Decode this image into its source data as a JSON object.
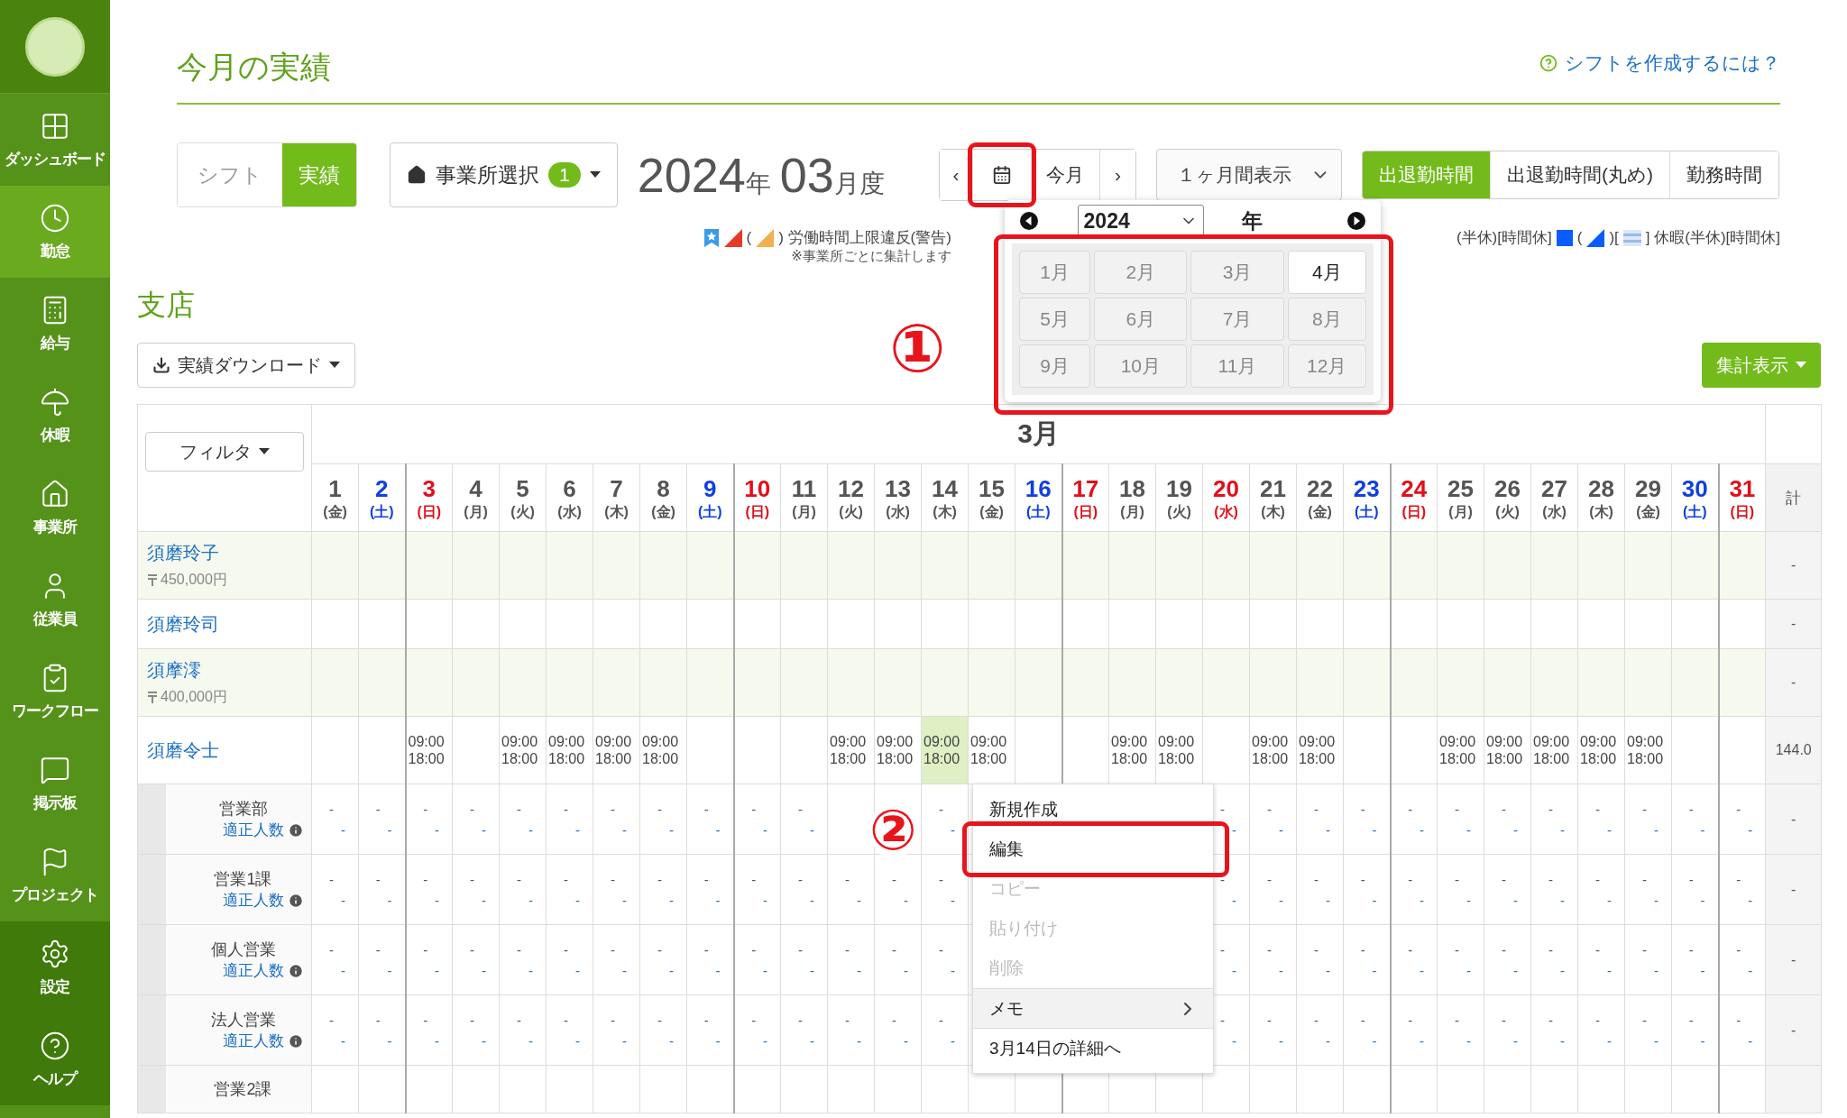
{
  "sidebar": {
    "items": [
      {
        "label": "ダッシュボード",
        "selected": false
      },
      {
        "label": "勤怠",
        "selected": true
      },
      {
        "label": "給与",
        "selected": false
      },
      {
        "label": "休暇",
        "selected": false
      },
      {
        "label": "事業所",
        "selected": false
      },
      {
        "label": "従業員",
        "selected": false
      },
      {
        "label": "ワークフロー",
        "selected": false
      },
      {
        "label": "掲示板",
        "selected": false
      },
      {
        "label": "プロジェクト",
        "selected": false
      }
    ],
    "bottom_items": [
      {
        "label": "設定",
        "selected": false
      },
      {
        "label": "ヘルプ",
        "selected": false
      }
    ]
  },
  "header": {
    "title": "今月の実績",
    "help_link": "シフトを作成するには？"
  },
  "toolbar": {
    "mode_tabs": [
      {
        "label": "シフト",
        "selected": false
      },
      {
        "label": "実績",
        "selected": true
      }
    ],
    "office_button": {
      "label": "事業所選択",
      "badge": "1"
    },
    "period": {
      "year": "2024",
      "year_unit": "年",
      "month": "03",
      "month_unit": "月度"
    },
    "nav": {
      "prev": "‹",
      "today": "今月",
      "next": "›",
      "calendar_annotated": true
    },
    "range_select": {
      "value": "１ヶ月間表示"
    },
    "view_tabs": [
      {
        "label": "出退勤時間",
        "selected": true
      },
      {
        "label": "出退勤時間(丸め)",
        "selected": false
      },
      {
        "label": "勤務時間",
        "selected": false
      }
    ]
  },
  "calendar_popup": {
    "year": "2024",
    "year_unit": "年",
    "annotated": true,
    "annotation": "①",
    "months": [
      {
        "label": "1月",
        "selected": false
      },
      {
        "label": "2月",
        "selected": false
      },
      {
        "label": "3月",
        "selected": false
      },
      {
        "label": "4月",
        "selected": true
      },
      {
        "label": "5月",
        "selected": false
      },
      {
        "label": "6月",
        "selected": false
      },
      {
        "label": "7月",
        "selected": false
      },
      {
        "label": "8月",
        "selected": false
      },
      {
        "label": "9月",
        "selected": false
      },
      {
        "label": "10月",
        "selected": false
      },
      {
        "label": "11月",
        "selected": false
      },
      {
        "label": "12月",
        "selected": false
      }
    ]
  },
  "legend": {
    "left": {
      "parts": [
        {
          "kind": "bookmark"
        },
        {
          "kind": "triangle",
          "color": "#e53a2a"
        },
        {
          "kind": "text",
          "text": "("
        },
        {
          "kind": "triangle",
          "color": "#f0b050"
        },
        {
          "kind": "text",
          "text": ") 労働時間上限違反(警告)"
        }
      ],
      "note": "※事業所ごとに集計します"
    },
    "right": {
      "parts": [
        {
          "kind": "text",
          "text": "(半休)[時間休]"
        },
        {
          "kind": "square",
          "color": "#0a5cff"
        },
        {
          "kind": "text",
          "text": "("
        },
        {
          "kind": "triangle",
          "color": "#0a5cff"
        },
        {
          "kind": "text",
          "text": ")["
        },
        {
          "kind": "stripes"
        },
        {
          "kind": "text",
          "text": "] 休暇(半休)[時間休]"
        }
      ]
    }
  },
  "section": {
    "title": "支店",
    "download_button": "実績ダウンロード",
    "summary_button": "集計表示"
  },
  "table": {
    "month_label": "3月",
    "filter_button": "フィルタ",
    "total_header": "計",
    "days": [
      {
        "num": "1",
        "wd": "(金)",
        "kind": "weekday"
      },
      {
        "num": "2",
        "wd": "(土)",
        "kind": "sat"
      },
      {
        "num": "3",
        "wd": "(日)",
        "kind": "sun"
      },
      {
        "num": "4",
        "wd": "(月)",
        "kind": "weekday"
      },
      {
        "num": "5",
        "wd": "(火)",
        "kind": "weekday"
      },
      {
        "num": "6",
        "wd": "(水)",
        "kind": "weekday"
      },
      {
        "num": "7",
        "wd": "(木)",
        "kind": "weekday"
      },
      {
        "num": "8",
        "wd": "(金)",
        "kind": "weekday"
      },
      {
        "num": "9",
        "wd": "(土)",
        "kind": "sat"
      },
      {
        "num": "10",
        "wd": "(日)",
        "kind": "sun"
      },
      {
        "num": "11",
        "wd": "(月)",
        "kind": "weekday"
      },
      {
        "num": "12",
        "wd": "(火)",
        "kind": "weekday"
      },
      {
        "num": "13",
        "wd": "(水)",
        "kind": "weekday"
      },
      {
        "num": "14",
        "wd": "(木)",
        "kind": "weekday"
      },
      {
        "num": "15",
        "wd": "(金)",
        "kind": "weekday"
      },
      {
        "num": "16",
        "wd": "(土)",
        "kind": "sat"
      },
      {
        "num": "17",
        "wd": "(日)",
        "kind": "sun"
      },
      {
        "num": "18",
        "wd": "(月)",
        "kind": "weekday"
      },
      {
        "num": "19",
        "wd": "(火)",
        "kind": "weekday"
      },
      {
        "num": "20",
        "wd": "(水)",
        "kind": "holiday"
      },
      {
        "num": "21",
        "wd": "(木)",
        "kind": "weekday"
      },
      {
        "num": "22",
        "wd": "(金)",
        "kind": "weekday"
      },
      {
        "num": "23",
        "wd": "(土)",
        "kind": "sat"
      },
      {
        "num": "24",
        "wd": "(日)",
        "kind": "sun"
      },
      {
        "num": "25",
        "wd": "(月)",
        "kind": "weekday"
      },
      {
        "num": "26",
        "wd": "(火)",
        "kind": "weekday"
      },
      {
        "num": "27",
        "wd": "(水)",
        "kind": "weekday"
      },
      {
        "num": "28",
        "wd": "(木)",
        "kind": "weekday"
      },
      {
        "num": "29",
        "wd": "(金)",
        "kind": "weekday"
      },
      {
        "num": "30",
        "wd": "(土)",
        "kind": "sat"
      },
      {
        "num": "31",
        "wd": "(日)",
        "kind": "sun"
      }
    ],
    "employees": [
      {
        "name": "須磨玲子",
        "salary": "450,000円",
        "shaded": true,
        "total": "-"
      },
      {
        "name": "須磨玲司",
        "shaded": false,
        "total": "-"
      },
      {
        "name": "須摩澪",
        "salary": "400,000円",
        "shaded": true,
        "total": "-"
      },
      {
        "name": "須磨令士",
        "shaded": false,
        "total": "144.0",
        "cells": [
          {
            "selected": false
          },
          {
            "selected": false
          },
          {
            "in": "09:00",
            "out": "18:00",
            "selected": false
          },
          {
            "selected": false
          },
          {
            "in": "09:00",
            "out": "18:00",
            "selected": false
          },
          {
            "in": "09:00",
            "out": "18:00",
            "selected": false
          },
          {
            "in": "09:00",
            "out": "18:00",
            "selected": false
          },
          {
            "in": "09:00",
            "out": "18:00",
            "selected": false
          },
          {
            "selected": false
          },
          {
            "selected": false
          },
          {
            "selected": false
          },
          {
            "in": "09:00",
            "out": "18:00",
            "selected": false
          },
          {
            "in": "09:00",
            "out": "18:00",
            "selected": false
          },
          {
            "in": "09:00",
            "out": "18:00",
            "selected": true
          },
          {
            "in": "09:00",
            "out": "18:00",
            "selected": false
          },
          {
            "selected": false
          },
          {
            "selected": false
          },
          {
            "in": "09:00",
            "out": "18:00",
            "selected": false
          },
          {
            "in": "09:00",
            "out": "18:00",
            "selected": false
          },
          {
            "selected": false
          },
          {
            "in": "09:00",
            "out": "18:00",
            "selected": false
          },
          {
            "in": "09:00",
            "out": "18:00",
            "selected": false
          },
          {
            "selected": false
          },
          {
            "selected": false
          },
          {
            "in": "09:00",
            "out": "18:00",
            "selected": false
          },
          {
            "in": "09:00",
            "out": "18:00",
            "selected": false
          },
          {
            "in": "09:00",
            "out": "18:00",
            "selected": false
          },
          {
            "in": "09:00",
            "out": "18:00",
            "selected": false
          },
          {
            "in": "09:00",
            "out": "18:00",
            "selected": false
          },
          {
            "selected": false
          },
          {
            "selected": false
          }
        ]
      }
    ],
    "groups": [
      {
        "label": "営業部",
        "link": "適正人数",
        "total": "-",
        "cells": [
          [
            "-",
            "-"
          ],
          [
            "-",
            "-"
          ],
          [
            "-",
            "-"
          ],
          [
            "-",
            "-"
          ],
          [
            "-",
            "-"
          ],
          [
            "-",
            "-"
          ],
          [
            "-",
            "-"
          ],
          [
            "-",
            "-"
          ],
          [
            "-",
            "-"
          ],
          [
            "-",
            "-"
          ],
          [
            "-",
            "-"
          ],
          null,
          null,
          [
            "-",
            "-"
          ],
          null,
          null,
          null,
          null,
          null,
          [
            "-",
            "-"
          ],
          [
            "-",
            "-"
          ],
          [
            "-",
            "-"
          ],
          [
            "-",
            "-"
          ],
          [
            "-",
            "-"
          ],
          [
            "-",
            "-"
          ],
          [
            "-",
            "-"
          ],
          [
            "-",
            "-"
          ],
          [
            "-",
            "-"
          ],
          [
            "-",
            "-"
          ],
          [
            "-",
            "-"
          ],
          [
            "-",
            "-"
          ]
        ]
      },
      {
        "label": "営業1課",
        "link": "適正人数",
        "total": "-",
        "cells": [
          [
            "-",
            "-"
          ],
          [
            "-",
            "-"
          ],
          [
            "-",
            "-"
          ],
          [
            "-",
            "-"
          ],
          [
            "-",
            "-"
          ],
          [
            "-",
            "-"
          ],
          [
            "-",
            "-"
          ],
          [
            "-",
            "-"
          ],
          [
            "-",
            "-"
          ],
          [
            "-",
            "-"
          ],
          [
            "-",
            "-"
          ],
          [
            "-",
            "-"
          ],
          [
            "-",
            "-"
          ],
          [
            "-",
            "-"
          ],
          null,
          null,
          null,
          null,
          null,
          [
            "-",
            "-"
          ],
          [
            "-",
            "-"
          ],
          [
            "-",
            "-"
          ],
          [
            "-",
            "-"
          ],
          [
            "-",
            "-"
          ],
          [
            "-",
            "-"
          ],
          [
            "-",
            "-"
          ],
          [
            "-",
            "-"
          ],
          [
            "-",
            "-"
          ],
          [
            "-",
            "-"
          ],
          [
            "-",
            "-"
          ],
          [
            "-",
            "-"
          ]
        ]
      },
      {
        "label": "個人営業",
        "link": "適正人数",
        "total": "-",
        "cells": [
          [
            "-",
            "-"
          ],
          [
            "-",
            "-"
          ],
          [
            "-",
            "-"
          ],
          [
            "-",
            "-"
          ],
          [
            "-",
            "-"
          ],
          [
            "-",
            "-"
          ],
          [
            "-",
            "-"
          ],
          [
            "-",
            "-"
          ],
          [
            "-",
            "-"
          ],
          [
            "-",
            "-"
          ],
          [
            "-",
            "-"
          ],
          [
            "-",
            "-"
          ],
          [
            "-",
            "-"
          ],
          [
            "-",
            "-"
          ],
          null,
          null,
          null,
          null,
          null,
          [
            "-",
            "-"
          ],
          [
            "-",
            "-"
          ],
          [
            "-",
            "-"
          ],
          [
            "-",
            "-"
          ],
          [
            "-",
            "-"
          ],
          [
            "-",
            "-"
          ],
          [
            "-",
            "-"
          ],
          [
            "-",
            "-"
          ],
          [
            "-",
            "-"
          ],
          [
            "-",
            "-"
          ],
          [
            "-",
            "-"
          ],
          [
            "-",
            "-"
          ]
        ]
      },
      {
        "label": "法人営業",
        "link": "適正人数",
        "total": "-",
        "cells": [
          [
            "-",
            "-"
          ],
          [
            "-",
            "-"
          ],
          [
            "-",
            "-"
          ],
          [
            "-",
            "-"
          ],
          [
            "-",
            "-"
          ],
          [
            "-",
            "-"
          ],
          [
            "-",
            "-"
          ],
          [
            "-",
            "-"
          ],
          [
            "-",
            "-"
          ],
          [
            "-",
            "-"
          ],
          [
            "-",
            "-"
          ],
          [
            "-",
            "-"
          ],
          [
            "-",
            "-"
          ],
          [
            "-",
            "-"
          ],
          null,
          null,
          null,
          null,
          null,
          [
            "-",
            "-"
          ],
          [
            "-",
            "-"
          ],
          [
            "-",
            "-"
          ],
          [
            "-",
            "-"
          ],
          [
            "-",
            "-"
          ],
          [
            "-",
            "-"
          ],
          [
            "-",
            "-"
          ],
          [
            "-",
            "-"
          ],
          [
            "-",
            "-"
          ],
          [
            "-",
            "-"
          ],
          [
            "-",
            "-"
          ],
          [
            "-",
            "-"
          ]
        ]
      },
      {
        "label": "営業2課"
      }
    ]
  },
  "context_menu": {
    "annotation": "②",
    "items": [
      {
        "label": "新規作成",
        "kind": "action",
        "disabled": false,
        "annotated": false
      },
      {
        "label": "編集",
        "kind": "action",
        "disabled": false,
        "annotated": true
      },
      {
        "label": "コピー",
        "kind": "action",
        "disabled": true,
        "annotated": false
      },
      {
        "label": "貼り付け",
        "kind": "action",
        "disabled": true,
        "annotated": false
      },
      {
        "label": "削除",
        "kind": "action",
        "disabled": true,
        "annotated": false
      },
      {
        "label": "メモ",
        "kind": "submenu",
        "disabled": false,
        "annotated": false
      },
      {
        "label": "3月14日の詳細へ",
        "kind": "link",
        "disabled": false,
        "annotated": false
      }
    ]
  }
}
